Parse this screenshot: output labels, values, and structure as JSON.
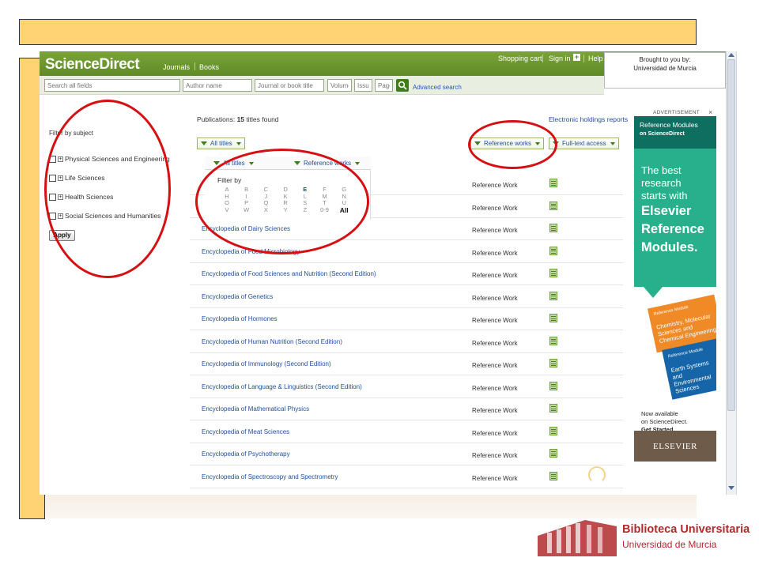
{
  "topnav": {
    "logo": "ScienceDirect",
    "journals": "Journals",
    "books": "Books",
    "shopping_cart": "Shopping cart",
    "sign_in": "Sign in",
    "help": "Help",
    "brought_to_you": "Brought to you by:",
    "institution": "Universidad de Murcia"
  },
  "search": {
    "all_fields_placeholder": "Search all fields",
    "author_placeholder": "Author name",
    "journal_placeholder": "Journal or book title",
    "volume_placeholder": "Volume",
    "issue_placeholder": "Issue",
    "page_placeholder": "Page",
    "advanced": "Advanced search"
  },
  "sidebar": {
    "title": "Filter by subject",
    "subjects": [
      "Physical Sciences and Engineering",
      "Life Sciences",
      "Health Sciences",
      "Social Sciences and Humanities"
    ],
    "apply": "Apply"
  },
  "main": {
    "count_label": "Publications:",
    "count_value": "15",
    "count_suffix": "titles found",
    "electronic_holdings": "Electronic holdings reports",
    "filter_all_titles": "All titles",
    "filter_reference_works": "Reference works",
    "filter_fulltext": "Full-text access",
    "popup_all_titles": "All titles",
    "popup_reference_works": "Reference works",
    "filter_by": "Filter by",
    "letters": [
      "A",
      "B",
      "C",
      "D",
      "E",
      "F",
      "G",
      "H",
      "I",
      "J",
      "K",
      "L",
      "M",
      "N",
      "O",
      "P",
      "Q",
      "R",
      "S",
      "T",
      "U",
      "V",
      "W",
      "X",
      "Y",
      "Z",
      "0-9",
      "All"
    ],
    "active_letter": "E",
    "rows": [
      {
        "title": "",
        "type": "Reference Work"
      },
      {
        "title": "",
        "type": "Reference Work"
      },
      {
        "title": "Encyclopedia of Dairy Sciences",
        "type": "Reference Work"
      },
      {
        "title": "Encyclopedia of Food Microbiology",
        "type": "Reference Work"
      },
      {
        "title": "Encyclopedia of Food Sciences and Nutrition (Second Edition)",
        "type": "Reference Work"
      },
      {
        "title": "Encyclopedia of Genetics",
        "type": "Reference Work"
      },
      {
        "title": "Encyclopedia of Hormones",
        "type": "Reference Work"
      },
      {
        "title": "Encyclopedia of Human Nutrition (Second Edition)",
        "type": "Reference Work"
      },
      {
        "title": "Encyclopedia of Immunology (Second Edition)",
        "type": "Reference Work"
      },
      {
        "title": "Encyclopedia of Language & Linguistics (Second Edition)",
        "type": "Reference Work"
      },
      {
        "title": "Encyclopedia of Mathematical Physics",
        "type": "Reference Work"
      },
      {
        "title": "Encyclopedia of Meat Sciences",
        "type": "Reference Work"
      },
      {
        "title": "Encyclopedia of Psychotherapy",
        "type": "Reference Work"
      },
      {
        "title": "Encyclopedia of Spectroscopy and Spectrometry",
        "type": "Reference Work"
      }
    ]
  },
  "ad": {
    "label": "ADVERTISEMENT",
    "close": "×",
    "top_line1": "Reference Modules",
    "top_line2": "on ScienceDirect",
    "head1": "The best",
    "head2": "research",
    "head3": "starts with",
    "head4": "Elsevier",
    "head5": "Reference",
    "head6": "Modules.",
    "book1_tag": "Reference Module",
    "book1_title": "Chemistry, Molecular Sciences and Chemical Engineering",
    "book2_tag": "Reference Module",
    "book2_title": "Earth Systems and Environmental Sciences",
    "avail1": "Now available",
    "avail2": "on ScienceDirect.",
    "avail3": "Get Started.",
    "brand": "ELSEVIER"
  },
  "footer_logo": {
    "name": "Biblioteca Universitaria",
    "sub": "Universidad de Murcia"
  },
  "colors": {
    "accent_green": "#5f8a26",
    "link_blue": "#1f4fa0",
    "annotation_red": "#d50f12",
    "slide_yellow": "#ffd374",
    "ad_teal": "#28b08d",
    "uni_red": "#b12a2e"
  }
}
